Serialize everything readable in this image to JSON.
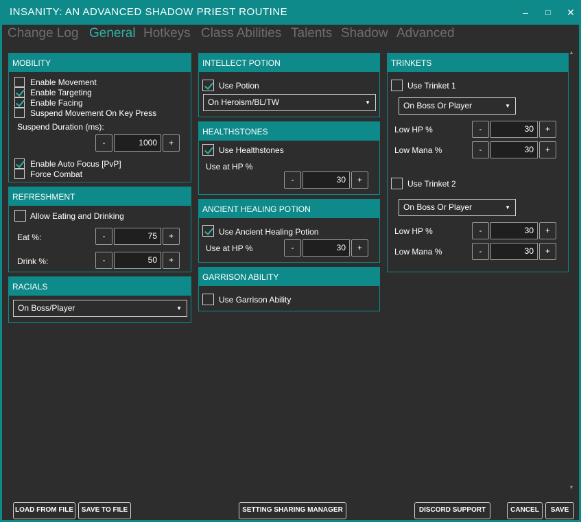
{
  "window": {
    "title": "INSANITY: AN ADVANCED SHADOW PRIEST ROUTINE",
    "minimize": "–",
    "maximize": "□",
    "close": "✕"
  },
  "tabs": [
    "Change Log",
    "General",
    "Hotkeys",
    "Class Abilities",
    "Talents",
    "Shadow",
    "Advanced"
  ],
  "active_tab": "General",
  "mobility": {
    "header": "MOBILITY",
    "enable_movement": {
      "label": "Enable Movement",
      "checked": false
    },
    "enable_targeting": {
      "label": "Enable Targeting",
      "checked": true
    },
    "enable_facing": {
      "label": "Enable Facing",
      "checked": true
    },
    "suspend_movement": {
      "label": "Suspend Movement On Key Press",
      "checked": false
    },
    "suspend_duration_label": "Suspend Duration (ms):",
    "suspend_duration_value": "1000",
    "enable_auto_focus": {
      "label": "Enable Auto Focus [PvP]",
      "checked": true
    },
    "force_combat": {
      "label": "Force Combat",
      "checked": false
    }
  },
  "refreshment": {
    "header": "REFRESHMENT",
    "allow_eating": {
      "label": "Allow Eating and Drinking",
      "checked": false
    },
    "eat_label": "Eat %:",
    "eat_value": "75",
    "drink_label": "Drink %:",
    "drink_value": "50"
  },
  "racials": {
    "header": "RACIALS",
    "selected": "On Boss/Player"
  },
  "intellect_potion": {
    "header": "INTELLECT POTION",
    "use_potion": {
      "label": "Use Potion",
      "checked": true
    },
    "selected": "On Heroism/BL/TW"
  },
  "healthstones": {
    "header": "HEALTHSTONES",
    "use": {
      "label": "Use Healthstones",
      "checked": true
    },
    "hp_label": "Use at HP %",
    "hp_value": "30"
  },
  "ancient_healing": {
    "header": "ANCIENT HEALING POTION",
    "use": {
      "label": "Use Ancient Healing Potion",
      "checked": true
    },
    "hp_label": "Use at HP %",
    "hp_value": "30"
  },
  "garrison": {
    "header": "GARRISON ABILITY",
    "use": {
      "label": "Use Garrison Ability",
      "checked": false
    }
  },
  "trinkets": {
    "header": "TRINKETS",
    "trinket1": {
      "label": "Use Trinket 1",
      "checked": false,
      "selected": "On Boss Or Player",
      "low_hp_label": "Low HP %",
      "low_hp_value": "30",
      "low_mana_label": "Low Mana %",
      "low_mana_value": "30"
    },
    "trinket2": {
      "label": "Use Trinket 2",
      "checked": false,
      "selected": "On Boss Or Player",
      "low_hp_label": "Low HP %",
      "low_hp_value": "30",
      "low_mana_label": "Low Mana %",
      "low_mana_value": "30"
    }
  },
  "stepper": {
    "minus": "-",
    "plus": "+"
  },
  "dropdown_arrow": "▼",
  "footer": {
    "load_from_file": "LOAD FROM FILE",
    "save_to_file": "SAVE TO FILE",
    "setting_sharing_manager": "SETTING SHARING MANAGER",
    "discord_support": "DISCORD SUPPORT",
    "cancel": "CANCEL",
    "save": "SAVE"
  },
  "colors": {
    "accent": "#0e8a8a",
    "active_tab": "#2fb3a5",
    "inactive_tab": "#6e6e6e",
    "background": "#2d2d2d"
  }
}
